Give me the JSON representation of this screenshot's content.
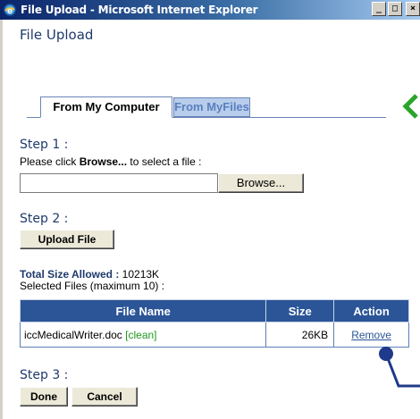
{
  "window": {
    "title": "File Upload - Microsoft Internet Explorer",
    "minimize_label": "_",
    "maximize_label": "□",
    "close_label": "×"
  },
  "page": {
    "title": "File Upload"
  },
  "tabs": [
    {
      "label": "From My Computer",
      "active": true
    },
    {
      "label": "From MyFiles",
      "active": false
    }
  ],
  "step1": {
    "label": "Step 1 :",
    "instruction_prefix": "Please click ",
    "instruction_bold": "Browse...",
    "instruction_suffix": " to select a file :",
    "file_value": "",
    "browse_label": "Browse..."
  },
  "step2": {
    "label": "Step 2 :",
    "upload_label": "Upload File"
  },
  "limits": {
    "total_size_label": "Total Size Allowed :",
    "total_size_value": " 10213K",
    "selected_files_text": "Selected Files (maximum 10) :"
  },
  "table": {
    "headers": [
      "File Name",
      "Size",
      "Action"
    ],
    "rows": [
      {
        "file_name": "iccMedicalWriter.doc",
        "status": "[clean]",
        "size": "26KB",
        "action": "Remove"
      }
    ]
  },
  "step3": {
    "label": "Step 3 :",
    "done_label": "Done",
    "cancel_label": "Cancel"
  },
  "colors": {
    "accent_blue": "#2b5597",
    "heading_navy": "#1f3a6b",
    "clean_green": "#1e9a1e",
    "marker_green": "#2aa52a",
    "callout_navy": "#1f3a8a"
  }
}
